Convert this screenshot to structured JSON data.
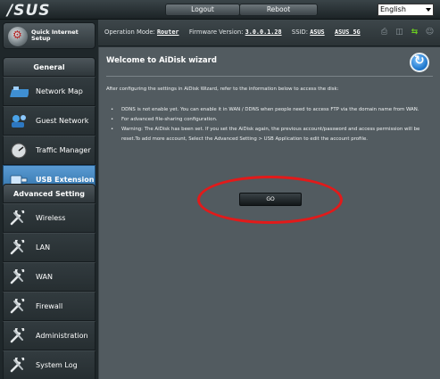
{
  "app": {
    "logo": "/SUS"
  },
  "topbar": {
    "logout": "Logout",
    "reboot": "Reboot",
    "language": "English"
  },
  "status": {
    "op_mode_label": "Operation Mode:",
    "op_mode_value": "Router",
    "firmware_label": "Firmware Version:",
    "firmware_value": "3.0.0.1.28",
    "ssid_label": "SSID:",
    "ssid_1": "ASUS",
    "ssid_2": "ASUS_5G",
    "icons": [
      "printer-icon",
      "router-icon",
      "usb-icon",
      "user-icon"
    ]
  },
  "sidebar": {
    "quick_setup": "Quick Internet Setup",
    "general_title": "General",
    "general_items": [
      {
        "label": "Network Map",
        "icon": "network-map-icon"
      },
      {
        "label": "Guest Network",
        "icon": "guest-network-icon"
      },
      {
        "label": "Traffic Manager",
        "icon": "traffic-manager-icon"
      },
      {
        "label": "USB Extension",
        "icon": "usb-extension-icon",
        "active": true
      }
    ],
    "advanced_title": "Advanced Setting",
    "advanced_items": [
      {
        "label": "Wireless",
        "icon": "wrench-icon"
      },
      {
        "label": "LAN",
        "icon": "wrench-icon"
      },
      {
        "label": "WAN",
        "icon": "wrench-icon"
      },
      {
        "label": "Firewall",
        "icon": "wrench-icon"
      },
      {
        "label": "Administration",
        "icon": "wrench-icon"
      },
      {
        "label": "System Log",
        "icon": "wrench-icon"
      }
    ]
  },
  "main": {
    "title": "Welcome to AiDisk wizard",
    "intro": "After configuring the settings in AiDisk Wizard, refer to the information below to access the disk:",
    "bullets": [
      "DDNS is not enable yet. You can enable it in WAN / DDNS when people need to access FTP via the domain name from WAN.",
      "For advanced file-sharing configuration.",
      "Warning: The AiDisk has been set. If you set the AiDisk again, the previous account/password and access permission will be reset.To add more account, Select the Advanced Setting > USB Application to edit the account profile."
    ],
    "go_label": "GO"
  },
  "colors": {
    "accent": "#3b82c4",
    "highlight_ring": "#e21a1a",
    "usb_status": "#6cd11f"
  }
}
